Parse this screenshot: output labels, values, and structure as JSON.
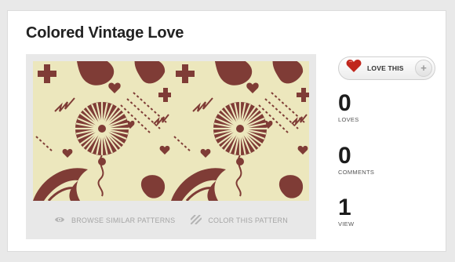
{
  "pattern_title": "Colored Vintage Love",
  "love_button": {
    "label": "LOVE THIS",
    "plus": "+"
  },
  "stats": [
    {
      "value": "0",
      "label": "LOVES"
    },
    {
      "value": "0",
      "label": "COMMENTS"
    },
    {
      "value": "1",
      "label": "VIEW"
    }
  ],
  "actions": {
    "browse": {
      "label": "BROWSE SIMILAR PATTERNS",
      "icon": "eye-icon"
    },
    "color": {
      "label": "COLOR THIS PATTERN",
      "icon": "stripes-icon"
    }
  },
  "colors": {
    "pattern_background": "#ece7bd",
    "pattern_motif": "#7f3c36",
    "heart_button": "#c0261c"
  }
}
